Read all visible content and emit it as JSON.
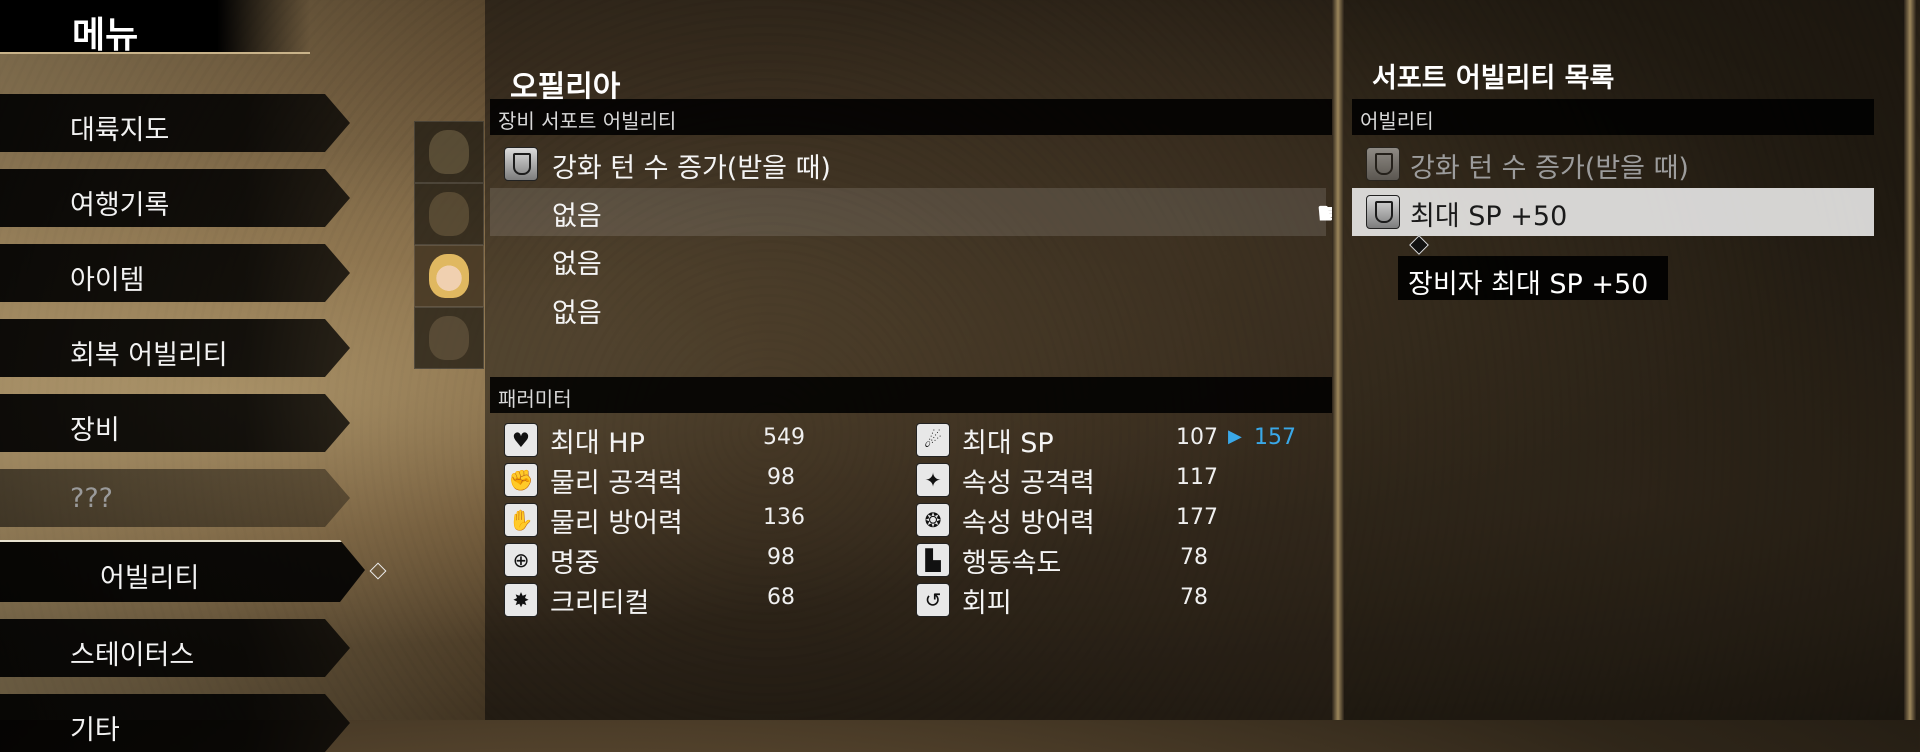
{
  "menu": {
    "title": "메뉴",
    "items": [
      {
        "label": "대륙지도"
      },
      {
        "label": "여행기록"
      },
      {
        "label": "아이템"
      },
      {
        "label": "회복 어빌리티"
      },
      {
        "label": "장비"
      },
      {
        "label": "???"
      },
      {
        "label": "어빌리티"
      },
      {
        "label": "스테이터스"
      },
      {
        "label": "기타"
      }
    ],
    "selected_index": 6
  },
  "party": {
    "portraits": [
      "party-member-1",
      "party-member-2",
      "party-member-3",
      "party-member-4"
    ],
    "selected_index": 2
  },
  "character": {
    "name": "오필리아",
    "support_section_title": "장비 서포트 어빌리티",
    "support_slots": [
      {
        "label": "강화 턴 수 증가(받을 때)",
        "icon": "support-ability-icon"
      },
      {
        "label": "없음"
      },
      {
        "label": "없음"
      },
      {
        "label": "없음"
      }
    ],
    "selected_slot": 1
  },
  "parameters": {
    "section_title": "패러미터",
    "left": [
      {
        "label": "최대 HP",
        "value": "549",
        "icon": "heart-icon"
      },
      {
        "label": "물리 공격력",
        "value": "98",
        "icon": "fist-icon"
      },
      {
        "label": "물리 방어력",
        "value": "136",
        "icon": "guard-icon"
      },
      {
        "label": "명중",
        "value": "98",
        "icon": "target-icon"
      },
      {
        "label": "크리티컬",
        "value": "68",
        "icon": "critical-icon"
      }
    ],
    "right": [
      {
        "label": "최대 SP",
        "value": "107",
        "new_value": "157",
        "icon": "sp-icon"
      },
      {
        "label": "속성 공격력",
        "value": "117",
        "icon": "elemental-attack-icon"
      },
      {
        "label": "속성 방어력",
        "value": "177",
        "icon": "elemental-defense-icon"
      },
      {
        "label": "행동속도",
        "value": "78",
        "icon": "boot-icon"
      },
      {
        "label": "회피",
        "value": "78",
        "icon": "evade-icon"
      }
    ]
  },
  "support_list": {
    "title": "서포트 어빌리티 목록",
    "column_header": "어빌리티",
    "items": [
      {
        "label": "강화 턴 수 증가(받을 때)",
        "state": "equipped"
      },
      {
        "label": "최대 SP +50",
        "state": "selected"
      }
    ],
    "tooltip": "장비자 최대 SP +50"
  },
  "colors": {
    "stat_increase": "#3aa8e8",
    "panel_black": "#000000"
  }
}
